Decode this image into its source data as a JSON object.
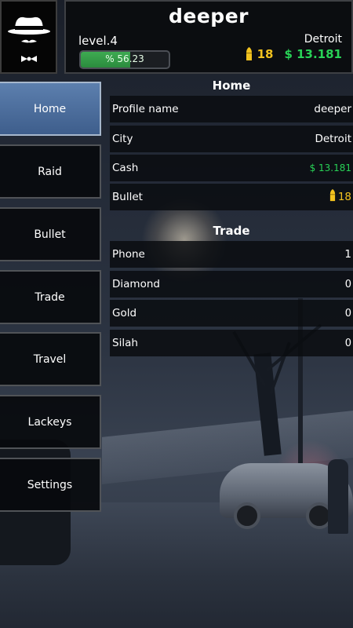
{
  "header": {
    "username": "deeper",
    "level": "level.4",
    "progress_text": "% 56.23",
    "progress_fraction": 0.5623,
    "city": "Detroit",
    "bullets": "18",
    "cash": "$ 13.181"
  },
  "menu": {
    "items": [
      {
        "label": "Home",
        "active": true
      },
      {
        "label": "Raid"
      },
      {
        "label": "Bullet"
      },
      {
        "label": "Trade"
      },
      {
        "label": "Travel"
      },
      {
        "label": "Lackeys"
      },
      {
        "label": "Settings"
      }
    ]
  },
  "home": {
    "title": "Home",
    "rows": [
      {
        "label": "Profile name",
        "value": "deeper"
      },
      {
        "label": "City",
        "value": "Detroit"
      },
      {
        "label": "Cash",
        "value": "$ 13.181"
      },
      {
        "label": "Bullet",
        "value": "18"
      }
    ]
  },
  "trade": {
    "title": "Trade",
    "rows": [
      {
        "label": "Phone",
        "value": "1"
      },
      {
        "label": "Diamond",
        "value": "0"
      },
      {
        "label": "Gold",
        "value": "0"
      },
      {
        "label": "Silah",
        "value": "0"
      }
    ]
  },
  "colors": {
    "cash": "#28d256",
    "bullet": "#f2c21f",
    "progress": "#3eaa52",
    "active_menu": "#4d6e9d"
  },
  "icons": {
    "avatar": "gangster-hat-icon",
    "bullet": "bullet-icon"
  }
}
